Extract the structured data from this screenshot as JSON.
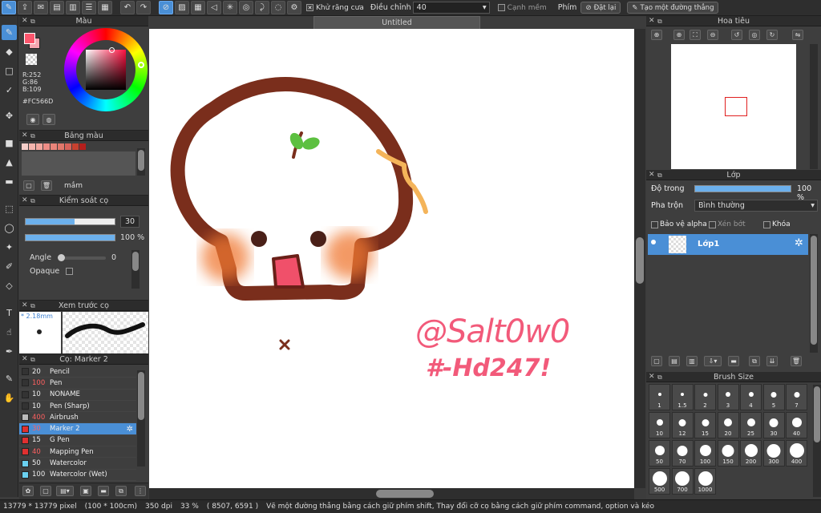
{
  "toolbar": {
    "antialias_label": "Khử răng cưa",
    "adjust_label": "Điều chỉnh",
    "adjust_value": "40",
    "soft_edge_label": "Cạnh mềm",
    "keys_label": "Phím",
    "reset_label": "Đặt lại",
    "straight_line_label": "Tạo một đường thẳng"
  },
  "canvas": {
    "title": "Untitled"
  },
  "color_panel": {
    "title": "Màu",
    "r": "R:252",
    "g": "G:86",
    "b": "B:109",
    "hex": "#FC566D",
    "main_color": "#fc566d",
    "secondary_color": "#f7a6b1"
  },
  "palette_panel": {
    "title": "Bảng màu",
    "swatches": [
      "#f4cdc8",
      "#f4b4ad",
      "#f2a79f",
      "#ee8d86",
      "#e9847a",
      "#e2776b",
      "#d8625a",
      "#c8412f",
      "#b41f1c"
    ],
    "folder_label": "mắm"
  },
  "brush_control": {
    "title": "Kiểm soát cọ",
    "size_value": "30",
    "size_fraction": 0.55,
    "opacity_value": "100 %",
    "opacity_fraction": 1.0,
    "angle_label": "Angle",
    "angle_value": "0",
    "opaque_label": "Opaque"
  },
  "brush_preview": {
    "title": "Xem trước cọ",
    "size_label": "* 2.18mm"
  },
  "brush_list": {
    "title": "Cọ: Marker 2",
    "items": [
      {
        "size": "20",
        "name": "Pencil",
        "color": "#333333",
        "red": false
      },
      {
        "size": "100",
        "name": "Pen",
        "color": "#333333",
        "red": true
      },
      {
        "size": "10",
        "name": "NONAME",
        "color": "#333333",
        "red": false
      },
      {
        "size": "10",
        "name": "Pen (Sharp)",
        "color": "#333333",
        "red": false
      },
      {
        "size": "400",
        "name": "Airbrush",
        "color": "#bbbbbb",
        "red": true
      },
      {
        "size": "30",
        "name": "Marker 2",
        "color": "#e03030",
        "red": true
      },
      {
        "size": "15",
        "name": "G Pen",
        "color": "#e03030",
        "red": false
      },
      {
        "size": "40",
        "name": "Mapping Pen",
        "color": "#e03030",
        "red": true
      },
      {
        "size": "50",
        "name": "Watercolor",
        "color": "#6ad0f0",
        "red": false
      },
      {
        "size": "100",
        "name": "Watercolor (Wet)",
        "color": "#6ad0f0",
        "red": false
      }
    ]
  },
  "navigator": {
    "title": "Hoa tiêu"
  },
  "layers": {
    "title": "Lớp",
    "opacity_label": "Độ trong",
    "opacity_value": "100 %",
    "opacity_fraction": 1.0,
    "blend_label": "Pha trộn",
    "blend_value": "Bình thường",
    "protect_alpha_label": "Bảo vệ alpha",
    "clip_label": "Xén bớt",
    "lock_label": "Khóa",
    "layer_name": "Lớp1"
  },
  "brush_size": {
    "title": "Brush Size",
    "sizes": [
      "1",
      "1.5",
      "2",
      "3",
      "4",
      "5",
      "7",
      "10",
      "12",
      "15",
      "20",
      "25",
      "30",
      "40",
      "50",
      "70",
      "100",
      "150",
      "200",
      "300",
      "400",
      "500",
      "700",
      "1000"
    ]
  },
  "artwork": {
    "watermark_line1": "@Salt0w0",
    "watermark_line2": "#-Hd247!",
    "outline_color": "#7a2e1c",
    "blush_color": "#f07830",
    "mouth_color": "#f0506a",
    "spark_color": "#f4b45a",
    "leaf_color": "#5cc040",
    "text_color": "#f25a7a"
  },
  "status": {
    "dimensions": "13779 * 13779 pixel",
    "physical": "(100 * 100cm)",
    "dpi": "350 dpi",
    "zoom": "33 %",
    "coords": "( 8507, 6591 )",
    "hint": "Vẽ một đường thẳng bằng cách giữ phím shift, Thay đổi cỡ cọ bằng cách giữ phím command, option và kéo"
  }
}
